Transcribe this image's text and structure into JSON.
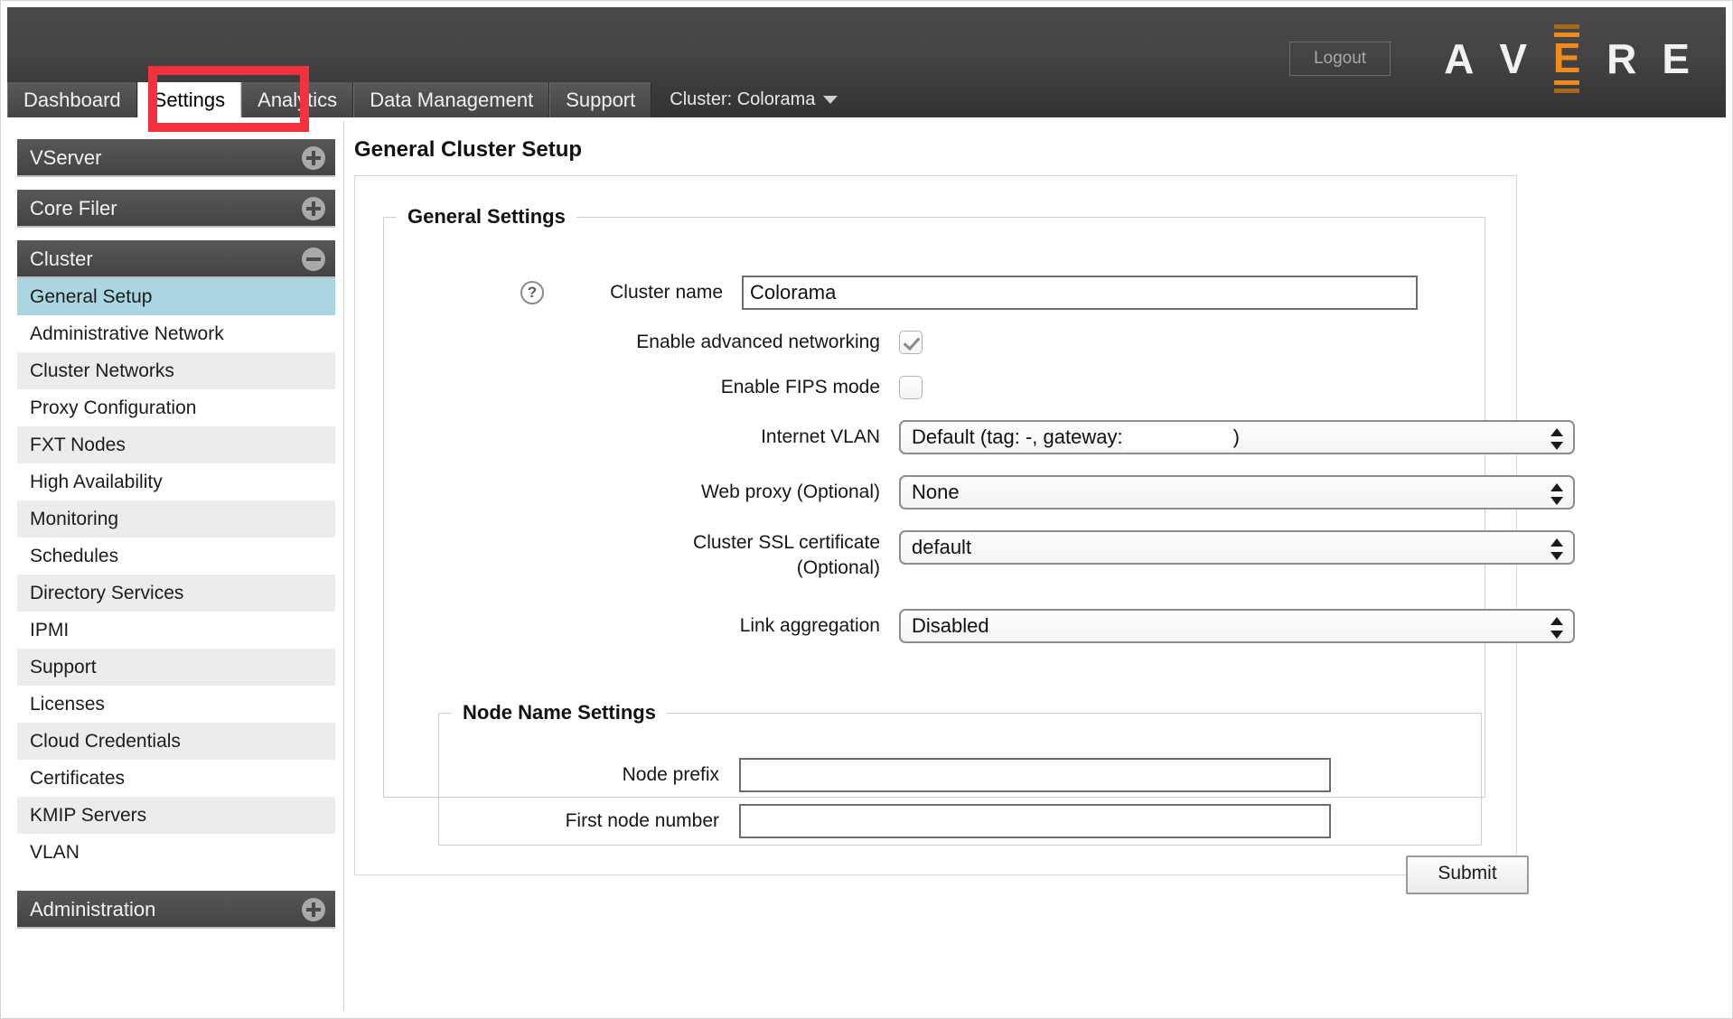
{
  "header": {
    "logout_label": "Logout",
    "brand": [
      "A",
      "V",
      "E",
      "R",
      "E"
    ],
    "brand_accent_color": "#f08a1c"
  },
  "tabs": [
    {
      "label": "Dashboard",
      "active": false
    },
    {
      "label": "Settings",
      "active": true
    },
    {
      "label": "Analytics",
      "active": false
    },
    {
      "label": "Data Management",
      "active": false
    },
    {
      "label": "Support",
      "active": false
    }
  ],
  "cluster_selector": {
    "label": "Cluster: Colorama"
  },
  "sidebar": {
    "groups": [
      {
        "title": "VServer",
        "toggle": "plus-icon",
        "expanded": false,
        "items": []
      },
      {
        "title": "Core Filer",
        "toggle": "plus-icon",
        "expanded": false,
        "items": []
      },
      {
        "title": "Cluster",
        "toggle": "minus-icon",
        "expanded": true,
        "items": [
          {
            "label": "General Setup",
            "selected": true
          },
          {
            "label": "Administrative Network",
            "selected": false
          },
          {
            "label": "Cluster Networks",
            "selected": false
          },
          {
            "label": "Proxy Configuration",
            "selected": false
          },
          {
            "label": "FXT Nodes",
            "selected": false
          },
          {
            "label": "High Availability",
            "selected": false
          },
          {
            "label": "Monitoring",
            "selected": false
          },
          {
            "label": "Schedules",
            "selected": false
          },
          {
            "label": "Directory Services",
            "selected": false
          },
          {
            "label": "IPMI",
            "selected": false
          },
          {
            "label": "Support",
            "selected": false
          },
          {
            "label": "Licenses",
            "selected": false
          },
          {
            "label": "Cloud Credentials",
            "selected": false
          },
          {
            "label": "Certificates",
            "selected": false
          },
          {
            "label": "KMIP Servers",
            "selected": false
          },
          {
            "label": "VLAN",
            "selected": false
          }
        ]
      },
      {
        "title": "Administration",
        "toggle": "plus-icon",
        "expanded": false,
        "items": []
      }
    ],
    "selected_highlight_color": "#a9d6e0"
  },
  "main": {
    "page_title": "General Cluster Setup",
    "general_settings": {
      "legend": "General Settings",
      "cluster_name": {
        "label": "Cluster name",
        "help": "?",
        "value": "Colorama",
        "placeholder": ""
      },
      "enable_advanced_networking": {
        "label": "Enable advanced networking",
        "checked": true
      },
      "enable_fips_mode": {
        "label": "Enable FIPS mode",
        "checked": false
      },
      "internet_vlan": {
        "label": "Internet VLAN",
        "value_prefix": "Default (tag: -, gateway:",
        "value_suffix": ")",
        "redacted": true
      },
      "web_proxy": {
        "label": "Web proxy (Optional)",
        "value": "None"
      },
      "cluster_ssl_certificate": {
        "label_line1": "Cluster SSL certificate",
        "label_line2": "(Optional)",
        "value": "default"
      },
      "link_aggregation": {
        "label": "Link aggregation",
        "value": "Disabled"
      }
    },
    "node_name_settings": {
      "legend": "Node Name Settings",
      "node_prefix": {
        "label": "Node prefix",
        "value": "",
        "placeholder": ""
      },
      "first_node_number": {
        "label": "First node number",
        "value": "",
        "placeholder": ""
      }
    },
    "submit_label": "Submit"
  },
  "annotation": {
    "highlight_target": "Settings",
    "color": "#f3313f"
  }
}
